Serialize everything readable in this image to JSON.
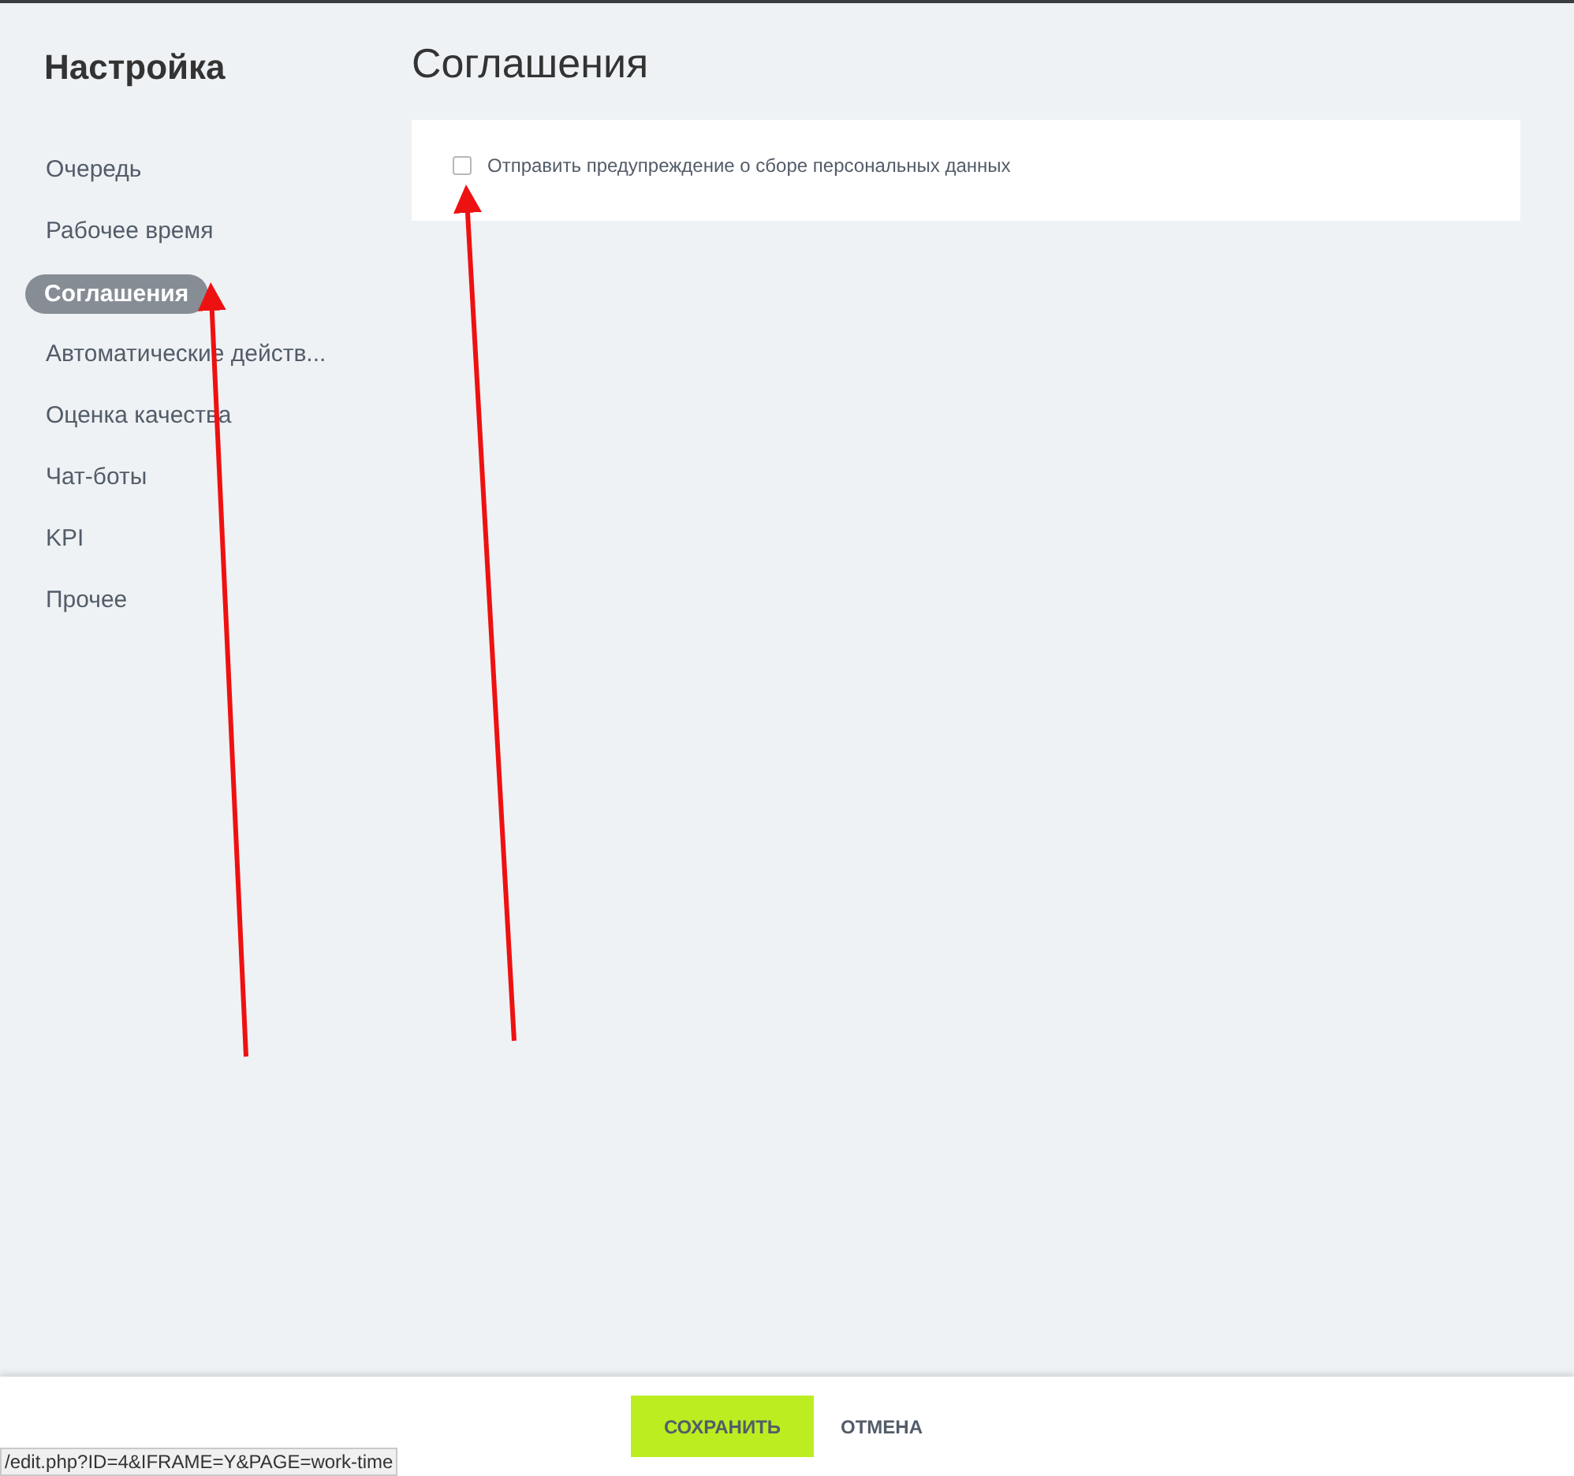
{
  "sidebar": {
    "title": "Настройка",
    "items": [
      {
        "label": "Очередь",
        "selected": false
      },
      {
        "label": "Рабочее время",
        "selected": false
      },
      {
        "label": "Соглашения",
        "selected": true
      },
      {
        "label": "Автоматические действ...",
        "selected": false
      },
      {
        "label": "Оценка качества",
        "selected": false
      },
      {
        "label": "Чат-боты",
        "selected": false
      },
      {
        "label": "KPI",
        "selected": false
      },
      {
        "label": "Прочее",
        "selected": false
      }
    ]
  },
  "page": {
    "title": "Соглашения",
    "options": [
      {
        "label": "Отправить предупреждение о сборе персональных данных",
        "checked": false
      }
    ]
  },
  "footer": {
    "buttons": [
      {
        "label": "СОХРАНИТЬ",
        "kind": "primary"
      },
      {
        "label": "ОТМЕНА",
        "kind": "link"
      }
    ]
  },
  "status_url": "/edit.php?ID=4&IFRAME=Y&PAGE=work-time"
}
